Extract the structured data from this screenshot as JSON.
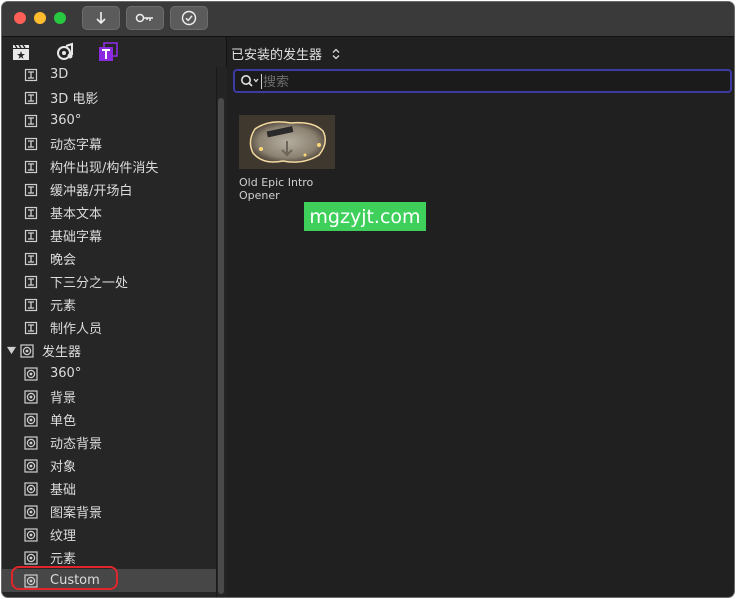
{
  "toolbar": {
    "import_icon": "down-arrow-icon",
    "keyword_icon": "key-icon",
    "check_icon": "checkmark-circle-icon"
  },
  "sidebar_tabs": [
    "clapperboard-icon",
    "music-icon",
    "titles-generators-icon"
  ],
  "main": {
    "title": "已安装的发生器",
    "search_placeholder": "搜索"
  },
  "sidebar": {
    "items": [
      {
        "label": "3D",
        "type": "title"
      },
      {
        "label": "3D 电影",
        "type": "title"
      },
      {
        "label": "360°",
        "type": "title"
      },
      {
        "label": "动态字幕",
        "type": "title"
      },
      {
        "label": "构件出现/构件消失",
        "type": "title"
      },
      {
        "label": "缓冲器/开场白",
        "type": "title"
      },
      {
        "label": "基本文本",
        "type": "title"
      },
      {
        "label": "基础字幕",
        "type": "title"
      },
      {
        "label": "晚会",
        "type": "title"
      },
      {
        "label": "下三分之一处",
        "type": "title"
      },
      {
        "label": "元素",
        "type": "title"
      },
      {
        "label": "制作人员",
        "type": "title"
      },
      {
        "label": "发生器",
        "type": "group"
      },
      {
        "label": "360°",
        "type": "generator"
      },
      {
        "label": "背景",
        "type": "generator"
      },
      {
        "label": "单色",
        "type": "generator"
      },
      {
        "label": "动态背景",
        "type": "generator"
      },
      {
        "label": "对象",
        "type": "generator"
      },
      {
        "label": "基础",
        "type": "generator"
      },
      {
        "label": "图案背景",
        "type": "generator"
      },
      {
        "label": "纹理",
        "type": "generator"
      },
      {
        "label": "元素",
        "type": "generator"
      },
      {
        "label": "Custom",
        "type": "generator",
        "selected": true
      }
    ]
  },
  "browser": {
    "items": [
      {
        "title": "Old Epic Intro Opener"
      }
    ]
  },
  "watermark": "mgzyjt.com",
  "colors": {
    "accent": "#3d3aa3",
    "titles_icon": "#8a2be2",
    "highlight": "#e0262a",
    "watermark_bg": "#3fd05c"
  }
}
